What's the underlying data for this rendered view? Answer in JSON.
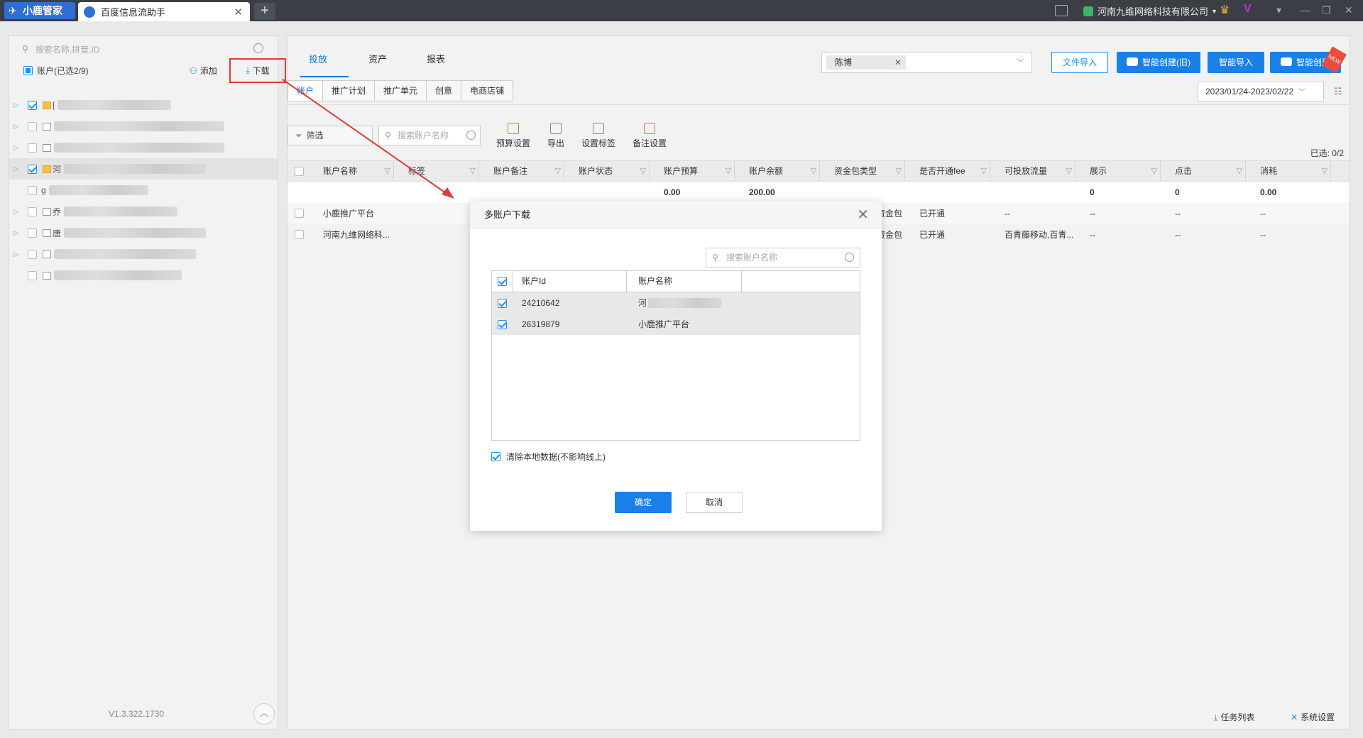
{
  "titlebar": {
    "brand": "小鹿管家",
    "tab_title": "百度信息流助手",
    "new_tab": "+",
    "company": "河南九维网络科技有限公司"
  },
  "left": {
    "search_placeholder": "搜索名称,拼音,ID",
    "accounts_label": "账户(已选2/9)",
    "add_label": "添加",
    "download_label": "下载",
    "tree_prefixes": [
      "[",
      "",
      "",
      "河",
      "g",
      "乔",
      "唐",
      "",
      ""
    ],
    "version": "V1.3.322.1730"
  },
  "main": {
    "tabs": [
      "投放",
      "资产",
      "报表"
    ],
    "filter_chip": "陈博",
    "buttons": {
      "file_import": "文件导入",
      "smart_old": "智能创建(旧)",
      "smart_import": "智能导入",
      "smart_create": "智能创建",
      "new_badge": "NEW"
    },
    "subtabs": [
      "账户",
      "推广计划",
      "推广单元",
      "创意",
      "电商店铺"
    ],
    "daterange": "2023/01/24-2023/02/22",
    "filter_label": "筛选",
    "search_placeholder": "搜索账户名称",
    "tools": [
      "预算设置",
      "导出",
      "设置标签",
      "备注设置"
    ],
    "selected": "已选: 0/2",
    "columns": [
      "账户名称",
      "标签",
      "账户备注",
      "账户状态",
      "账户预算",
      "账户余额",
      "资金包类型",
      "是否开通fee",
      "可投放流量",
      "展示",
      "点击",
      "消耗"
    ],
    "summary": {
      "budget": "0.00",
      "balance": "200.00",
      "show": "0",
      "click": "0",
      "cost": "0.00"
    },
    "rows": [
      {
        "name": "小鹿推广平台",
        "fund": "资金包",
        "fee": "已开通",
        "traffic": "--",
        "show": "--",
        "click": "--",
        "cost": "--"
      },
      {
        "name": "河南九维网络科...",
        "fund": "资金包",
        "fee": "已开通",
        "traffic": "百青藤移动,百青...",
        "show": "--",
        "click": "--",
        "cost": "--"
      }
    ],
    "task_list": "任务列表",
    "system_settings": "系统设置"
  },
  "dialog": {
    "title": "多账户下载",
    "search_placeholder": "搜索账户名称",
    "col_id": "账户Id",
    "col_name": "账户名称",
    "rows": [
      {
        "id": "24210642",
        "name": "河"
      },
      {
        "id": "26319879",
        "name": "小鹿推广平台"
      }
    ],
    "clear_label": "清除本地数据(不影响线上)",
    "ok": "确定",
    "cancel": "取消"
  },
  "colors": {
    "accent": "#1a80e8",
    "highlight": "#e23a3a"
  }
}
